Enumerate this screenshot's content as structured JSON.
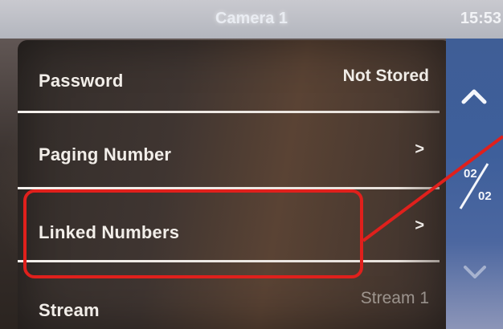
{
  "header": {
    "title": "Camera 1",
    "time": "15:53"
  },
  "menu": {
    "items": [
      {
        "label": "Password",
        "value": "Not Stored"
      },
      {
        "label": "Paging Number",
        "value": ">"
      },
      {
        "label": "Linked Numbers",
        "value": ">"
      },
      {
        "label": "Stream",
        "value": "Stream 1"
      }
    ]
  },
  "pager": {
    "current": "02",
    "total": "02"
  },
  "icons": {
    "up": "chevron-up-icon",
    "down": "chevron-down-icon"
  },
  "colors": {
    "sidebar": "#3e5f9b",
    "annotation": "#e0201c",
    "topbar": "#b8bac1"
  }
}
